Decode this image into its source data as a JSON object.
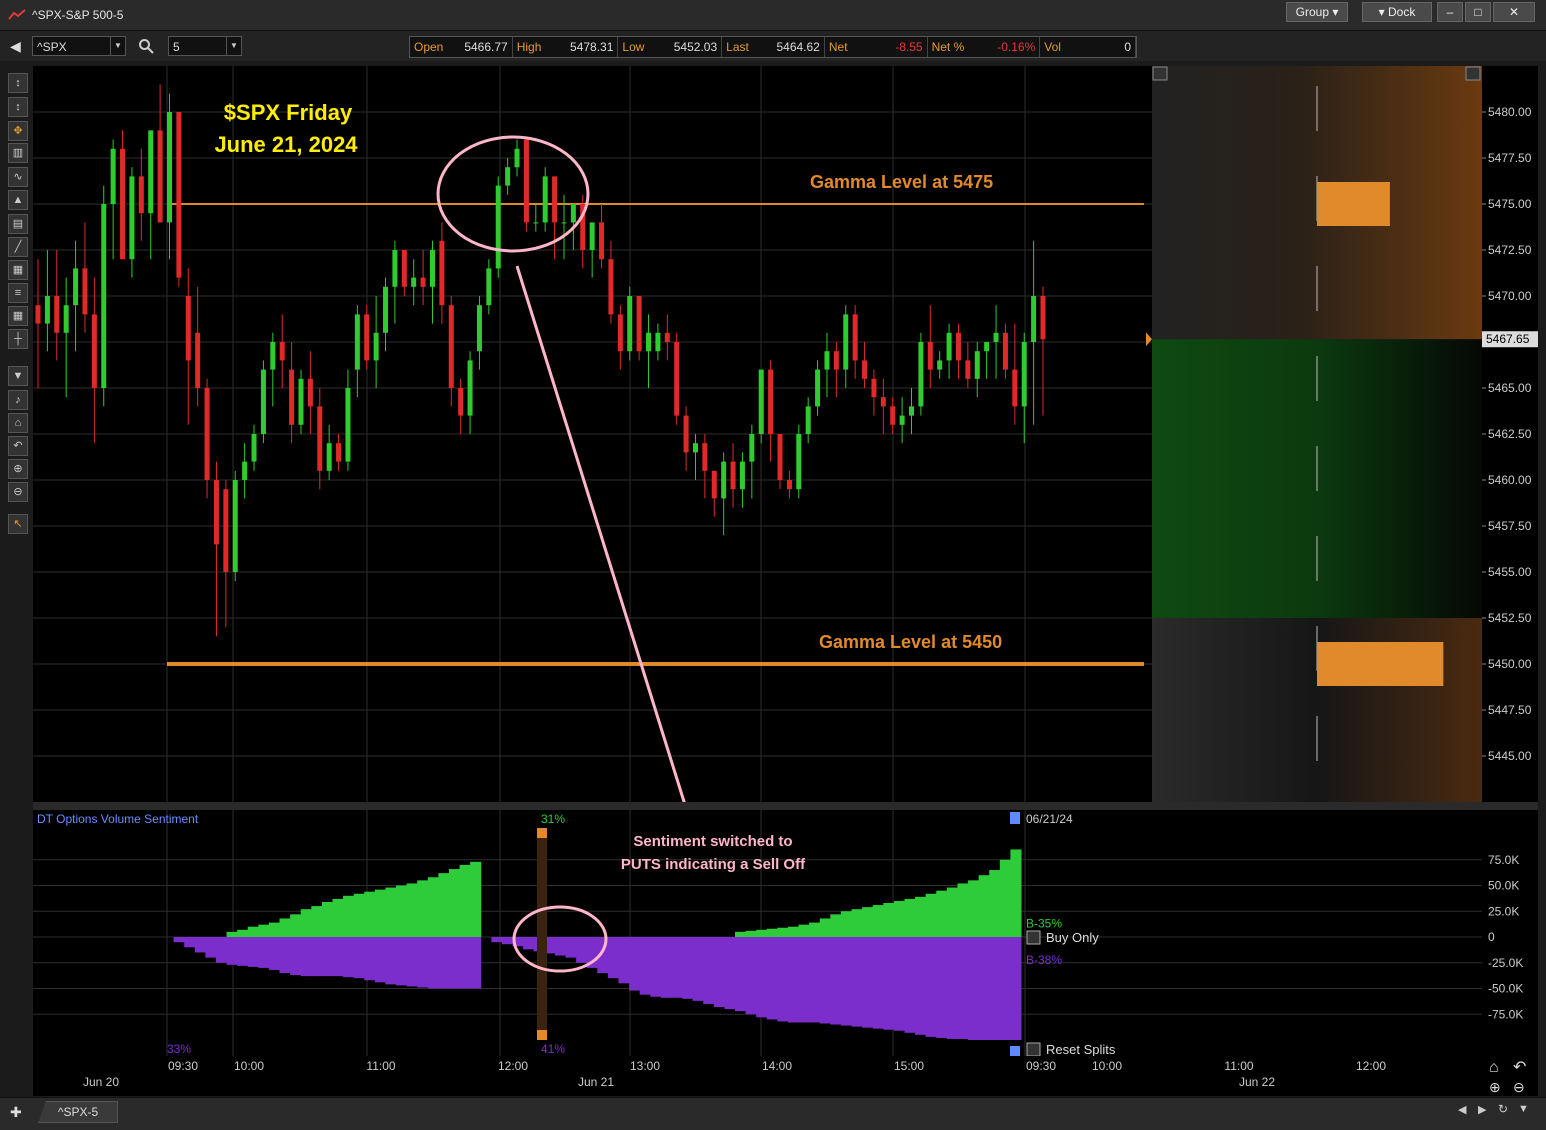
{
  "window": {
    "title": "^SPX-S&P 500-5",
    "group_label": "Group",
    "dock_label": "Dock",
    "min_icon": "minimize-icon",
    "max_icon": "maximize-icon",
    "close_icon": "close-icon"
  },
  "toolbar": {
    "symbol": "^SPX",
    "interval": "5",
    "quote": [
      {
        "key": "Open",
        "value": "5466.77"
      },
      {
        "key": "High",
        "value": "5478.31"
      },
      {
        "key": "Low",
        "value": "5452.03"
      },
      {
        "key": "Last",
        "value": "5464.62"
      },
      {
        "key": "Net",
        "value": "-8.55"
      },
      {
        "key": "Net %",
        "value": "-0.16%"
      },
      {
        "key": "Vol",
        "value": "0"
      }
    ]
  },
  "annotations": {
    "title_line1": "$SPX Friday",
    "title_line2": "June 21, 2024",
    "gamma_top": "Gamma Level at 5475",
    "gamma_bottom": "Gamma Level at 5450",
    "sentiment_line1": "Sentiment switched to",
    "sentiment_line2": "PUTS indicating a Sell Off"
  },
  "chart_data": [
    {
      "type": "candlestick",
      "title": "",
      "ylim": [
        5442.5,
        5482.5
      ],
      "y_ticks": [
        "5480.00",
        "5477.50",
        "5475.00",
        "5472.50",
        "5470.00",
        "5467.50",
        "5465.00",
        "5462.50",
        "5460.00",
        "5457.50",
        "5455.00",
        "5452.50",
        "5450.00",
        "5447.50",
        "5445.00"
      ],
      "last_price_label": "5467.65",
      "reference_lines": [
        {
          "label": "Gamma Level at 5475",
          "y": 5475.0
        },
        {
          "label": "Gamma Level at 5450",
          "y": 5450.0
        }
      ],
      "gex_profile": [
        {
          "range": [
            5452.5,
            5467.65
          ],
          "color": "#0f4a12"
        },
        {
          "range": [
            5467.65,
            5482.5
          ],
          "color": "#6b3a10"
        }
      ],
      "gex_bars": [
        {
          "y": 5475.0,
          "size": 0.45
        },
        {
          "y": 5450.0,
          "size": 0.78
        }
      ],
      "candles": [
        [
          5469.5,
          5472.0,
          5465.0,
          5468.5
        ],
        [
          5468.5,
          5472.5,
          5467.0,
          5470.0
        ],
        [
          5470.0,
          5472.5,
          5466.5,
          5468.0
        ],
        [
          5468.0,
          5471.0,
          5464.5,
          5469.5
        ],
        [
          5469.5,
          5473.0,
          5467.0,
          5471.5
        ],
        [
          5471.5,
          5474.0,
          5468.0,
          5469.0
        ],
        [
          5469.0,
          5471.0,
          5462.0,
          5465.0
        ],
        [
          5465.0,
          5476.0,
          5464.0,
          5475.0
        ],
        [
          5475.0,
          5478.5,
          5472.0,
          5478.0
        ],
        [
          5478.0,
          5479.0,
          5474.0,
          5472.0
        ],
        [
          5472.0,
          5477.0,
          5471.0,
          5476.5
        ],
        [
          5476.5,
          5478.0,
          5473.0,
          5474.5
        ],
        [
          5474.5,
          5479.0,
          5472.0,
          5479.0
        ],
        [
          5479.0,
          5481.5,
          5477.0,
          5474.0
        ],
        [
          5474.0,
          5481.0,
          5472.0,
          5480.0
        ],
        [
          5480.0,
          5480.0,
          5470.5,
          5471.0
        ],
        [
          5470.0,
          5471.5,
          5463.0,
          5466.5
        ],
        [
          5468.0,
          5470.5,
          5464.0,
          5465.0
        ],
        [
          5465.0,
          5465.5,
          5459.0,
          5460.0
        ],
        [
          5460.0,
          5461.0,
          5451.5,
          5456.5
        ],
        [
          5459.5,
          5460.0,
          5452.0,
          5455.0
        ],
        [
          5455.0,
          5460.5,
          5454.5,
          5460.0
        ],
        [
          5460.0,
          5462.0,
          5459.0,
          5461.0
        ],
        [
          5461.0,
          5463.0,
          5460.5,
          5462.5
        ],
        [
          5462.5,
          5466.5,
          5462.0,
          5466.0
        ],
        [
          5466.0,
          5468.0,
          5464.0,
          5467.5
        ],
        [
          5467.5,
          5469.0,
          5465.0,
          5466.5
        ],
        [
          5466.0,
          5467.5,
          5462.0,
          5463.0
        ],
        [
          5463.0,
          5466.0,
          5462.5,
          5465.5
        ],
        [
          5465.5,
          5467.0,
          5462.5,
          5464.0
        ],
        [
          5464.0,
          5465.0,
          5459.5,
          5460.5
        ],
        [
          5460.5,
          5463.0,
          5460.0,
          5462.0
        ],
        [
          5462.0,
          5462.5,
          5460.5,
          5461.0
        ],
        [
          5461.0,
          5466.0,
          5460.5,
          5465.0
        ],
        [
          5466.0,
          5469.5,
          5464.5,
          5469.0
        ],
        [
          5469.0,
          5469.5,
          5466.0,
          5466.5
        ],
        [
          5466.5,
          5470.0,
          5465.0,
          5468.0
        ],
        [
          5468.0,
          5471.0,
          5467.0,
          5470.5
        ],
        [
          5470.5,
          5473.0,
          5468.5,
          5472.5
        ],
        [
          5472.5,
          5472.5,
          5470.0,
          5470.5
        ],
        [
          5470.5,
          5472.0,
          5469.5,
          5471.0
        ],
        [
          5471.0,
          5472.5,
          5469.5,
          5470.5
        ],
        [
          5470.5,
          5473.0,
          5468.5,
          5472.5
        ],
        [
          5473.0,
          5474.0,
          5468.5,
          5469.5
        ],
        [
          5469.5,
          5470.0,
          5464.0,
          5465.0
        ],
        [
          5465.0,
          5465.5,
          5462.5,
          5463.5
        ],
        [
          5463.5,
          5467.0,
          5462.5,
          5466.5
        ],
        [
          5467.0,
          5470.0,
          5466.0,
          5469.5
        ],
        [
          5469.5,
          5472.0,
          5469.0,
          5471.5
        ],
        [
          5471.5,
          5476.5,
          5471.0,
          5476.0
        ],
        [
          5476.0,
          5477.5,
          5475.5,
          5477.0
        ],
        [
          5477.0,
          5478.5,
          5476.5,
          5478.0
        ],
        [
          5478.5,
          5478.5,
          5473.5,
          5474.0
        ],
        [
          5474.0,
          5475.0,
          5473.5,
          5474.0
        ],
        [
          5474.0,
          5477.0,
          5473.5,
          5476.5
        ],
        [
          5476.5,
          5476.5,
          5472.0,
          5474.0
        ],
        [
          5474.0,
          5475.5,
          5472.0,
          5474.0
        ],
        [
          5474.0,
          5475.0,
          5472.5,
          5475.0
        ],
        [
          5475.0,
          5475.5,
          5471.5,
          5472.5
        ],
        [
          5472.5,
          5474.0,
          5471.0,
          5474.0
        ],
        [
          5474.0,
          5475.0,
          5471.5,
          5472.0
        ],
        [
          5472.0,
          5473.0,
          5468.5,
          5469.0
        ],
        [
          5469.0,
          5469.5,
          5466.0,
          5467.0
        ],
        [
          5467.0,
          5470.5,
          5466.5,
          5470.0
        ],
        [
          5470.0,
          5470.0,
          5466.5,
          5467.0
        ],
        [
          5467.0,
          5469.0,
          5465.0,
          5468.0
        ],
        [
          5467.0,
          5468.5,
          5466.5,
          5468.0
        ],
        [
          5468.0,
          5469.0,
          5466.5,
          5467.5
        ],
        [
          5467.5,
          5468.0,
          5463.0,
          5463.5
        ],
        [
          5463.5,
          5464.0,
          5460.5,
          5461.5
        ],
        [
          5461.5,
          5462.5,
          5460.0,
          5462.0
        ],
        [
          5462.0,
          5462.5,
          5459.0,
          5460.5
        ],
        [
          5460.5,
          5460.5,
          5458.0,
          5459.0
        ],
        [
          5459.0,
          5461.5,
          5457.0,
          5461.0
        ],
        [
          5461.0,
          5462.0,
          5458.5,
          5459.5
        ],
        [
          5459.5,
          5461.5,
          5458.5,
          5461.0
        ],
        [
          5461.0,
          5463.0,
          5459.0,
          5462.5
        ],
        [
          5462.5,
          5466.0,
          5462.0,
          5466.0
        ],
        [
          5466.0,
          5466.5,
          5461.0,
          5462.5
        ],
        [
          5462.5,
          5462.5,
          5459.5,
          5460.0
        ],
        [
          5460.0,
          5460.5,
          5459.0,
          5459.5
        ],
        [
          5459.5,
          5463.0,
          5459.0,
          5462.5
        ],
        [
          5462.5,
          5464.5,
          5462.0,
          5464.0
        ],
        [
          5464.0,
          5466.5,
          5463.5,
          5466.0
        ],
        [
          5466.0,
          5468.0,
          5464.5,
          5467.0
        ],
        [
          5467.0,
          5467.5,
          5464.5,
          5466.0
        ],
        [
          5466.0,
          5469.5,
          5465.0,
          5469.0
        ],
        [
          5469.0,
          5469.5,
          5465.5,
          5466.5
        ],
        [
          5466.5,
          5467.5,
          5465.0,
          5465.5
        ],
        [
          5465.5,
          5466.0,
          5463.5,
          5464.5
        ],
        [
          5464.5,
          5465.5,
          5462.5,
          5464.0
        ],
        [
          5464.0,
          5464.5,
          5462.5,
          5463.0
        ],
        [
          5463.0,
          5464.5,
          5462.0,
          5463.5
        ],
        [
          5463.5,
          5465.0,
          5462.5,
          5464.0
        ],
        [
          5464.0,
          5468.0,
          5463.5,
          5467.5
        ],
        [
          5467.5,
          5469.5,
          5465.0,
          5466.0
        ],
        [
          5466.0,
          5467.0,
          5465.5,
          5466.5
        ],
        [
          5466.5,
          5468.5,
          5465.5,
          5468.0
        ],
        [
          5468.0,
          5468.5,
          5465.5,
          5466.5
        ],
        [
          5466.5,
          5467.5,
          5465.0,
          5465.5
        ],
        [
          5465.5,
          5467.5,
          5464.5,
          5467.0
        ],
        [
          5467.0,
          5467.5,
          5465.5,
          5467.5
        ],
        [
          5467.5,
          5469.5,
          5465.5,
          5468.0
        ],
        [
          5468.0,
          5468.5,
          5465.5,
          5466.0
        ],
        [
          5466.0,
          5468.5,
          5463.0,
          5464.0
        ],
        [
          5464.0,
          5468.0,
          5462.0,
          5467.5
        ],
        [
          5467.5,
          5473.0,
          5463.0,
          5470.0
        ],
        [
          5470.0,
          5470.5,
          5463.5,
          5467.65
        ]
      ]
    },
    {
      "type": "area",
      "title": "DT Options Volume Sentiment",
      "ylim": [
        -100000,
        100000
      ],
      "y_ticks": [
        "75.0K",
        "50.0K",
        "25.0K",
        "0",
        "-25.0K",
        "-50.0K",
        "-75.0K"
      ],
      "series": [
        {
          "name": "B-35%",
          "values": [
            0,
            0,
            0,
            0,
            0,
            0,
            5000,
            7000,
            10000,
            12000,
            14000,
            18000,
            22000,
            27000,
            30000,
            34000,
            37000,
            40000,
            42000,
            44000,
            46000,
            48000,
            50000,
            52000,
            55000,
            58000,
            62000,
            66000,
            70000,
            73000,
            0,
            0,
            0,
            0,
            0,
            0,
            0,
            0,
            0,
            0,
            0,
            0,
            0,
            0,
            0,
            0,
            0,
            0,
            0,
            0,
            0,
            0,
            0,
            0,
            5000,
            6000,
            7000,
            8000,
            9000,
            10000,
            12000,
            14000,
            18000,
            22000,
            25000,
            27000,
            29000,
            31000,
            33000,
            35000,
            37000,
            39000,
            42000,
            45000,
            48000,
            52000,
            55000,
            60000,
            65000,
            75000,
            85000
          ]
        },
        {
          "name": "B-38%",
          "values": [
            0,
            -5000,
            -10000,
            -15000,
            -20000,
            -25000,
            -27000,
            -28000,
            -29000,
            -30000,
            -32000,
            -35000,
            -37000,
            -38000,
            -38000,
            -38000,
            -38000,
            -39000,
            -40000,
            -42000,
            -44000,
            -46000,
            -47000,
            -48000,
            -49000,
            -50000,
            -50000,
            -50000,
            -50000,
            -50000,
            0,
            -5000,
            -7000,
            -9000,
            -12000,
            -14000,
            -16000,
            -18000,
            -20000,
            -25000,
            -30000,
            -35000,
            -40000,
            -45000,
            -52000,
            -56000,
            -58000,
            -59000,
            -59000,
            -60000,
            -62000,
            -65000,
            -68000,
            -70000,
            -72000,
            -75000,
            -78000,
            -80000,
            -82000,
            -83000,
            -83000,
            -83000,
            -84000,
            -85000,
            -86000,
            -87000,
            -88000,
            -89000,
            -90000,
            -91000,
            -93000,
            -95000,
            -97000,
            -98000,
            -99000,
            -99000,
            -100000,
            -100000,
            -100000,
            -100000,
            -100000
          ]
        }
      ],
      "pct_labels": {
        "top_left": "",
        "bottom_left": "33%",
        "top_switch": "31%",
        "bottom_switch": "41%"
      },
      "date_label": "06/21/24",
      "controls": {
        "buy_only": "Buy Only",
        "reset_splits": "Reset Splits"
      }
    }
  ],
  "x_axis": {
    "time_ticks": [
      "09:30",
      "10:00",
      "11:00",
      "12:00",
      "13:00",
      "14:00",
      "15:00",
      "09:30",
      "10:00",
      "11:00",
      "12:00"
    ],
    "date_ticks": [
      "Jun 20",
      "Jun 21",
      "Jun 22"
    ]
  },
  "statusbar": {
    "tab_label": "^SPX-5"
  },
  "colors": {
    "up": "#2ecc2e",
    "down": "#e02a2a",
    "gamma": "#e08a2c",
    "annotation_title": "#ffee00",
    "annotation_pink": "#ffb6c8",
    "sentiment_green": "#2ecc3a",
    "sentiment_purple": "#7b2ecc"
  }
}
